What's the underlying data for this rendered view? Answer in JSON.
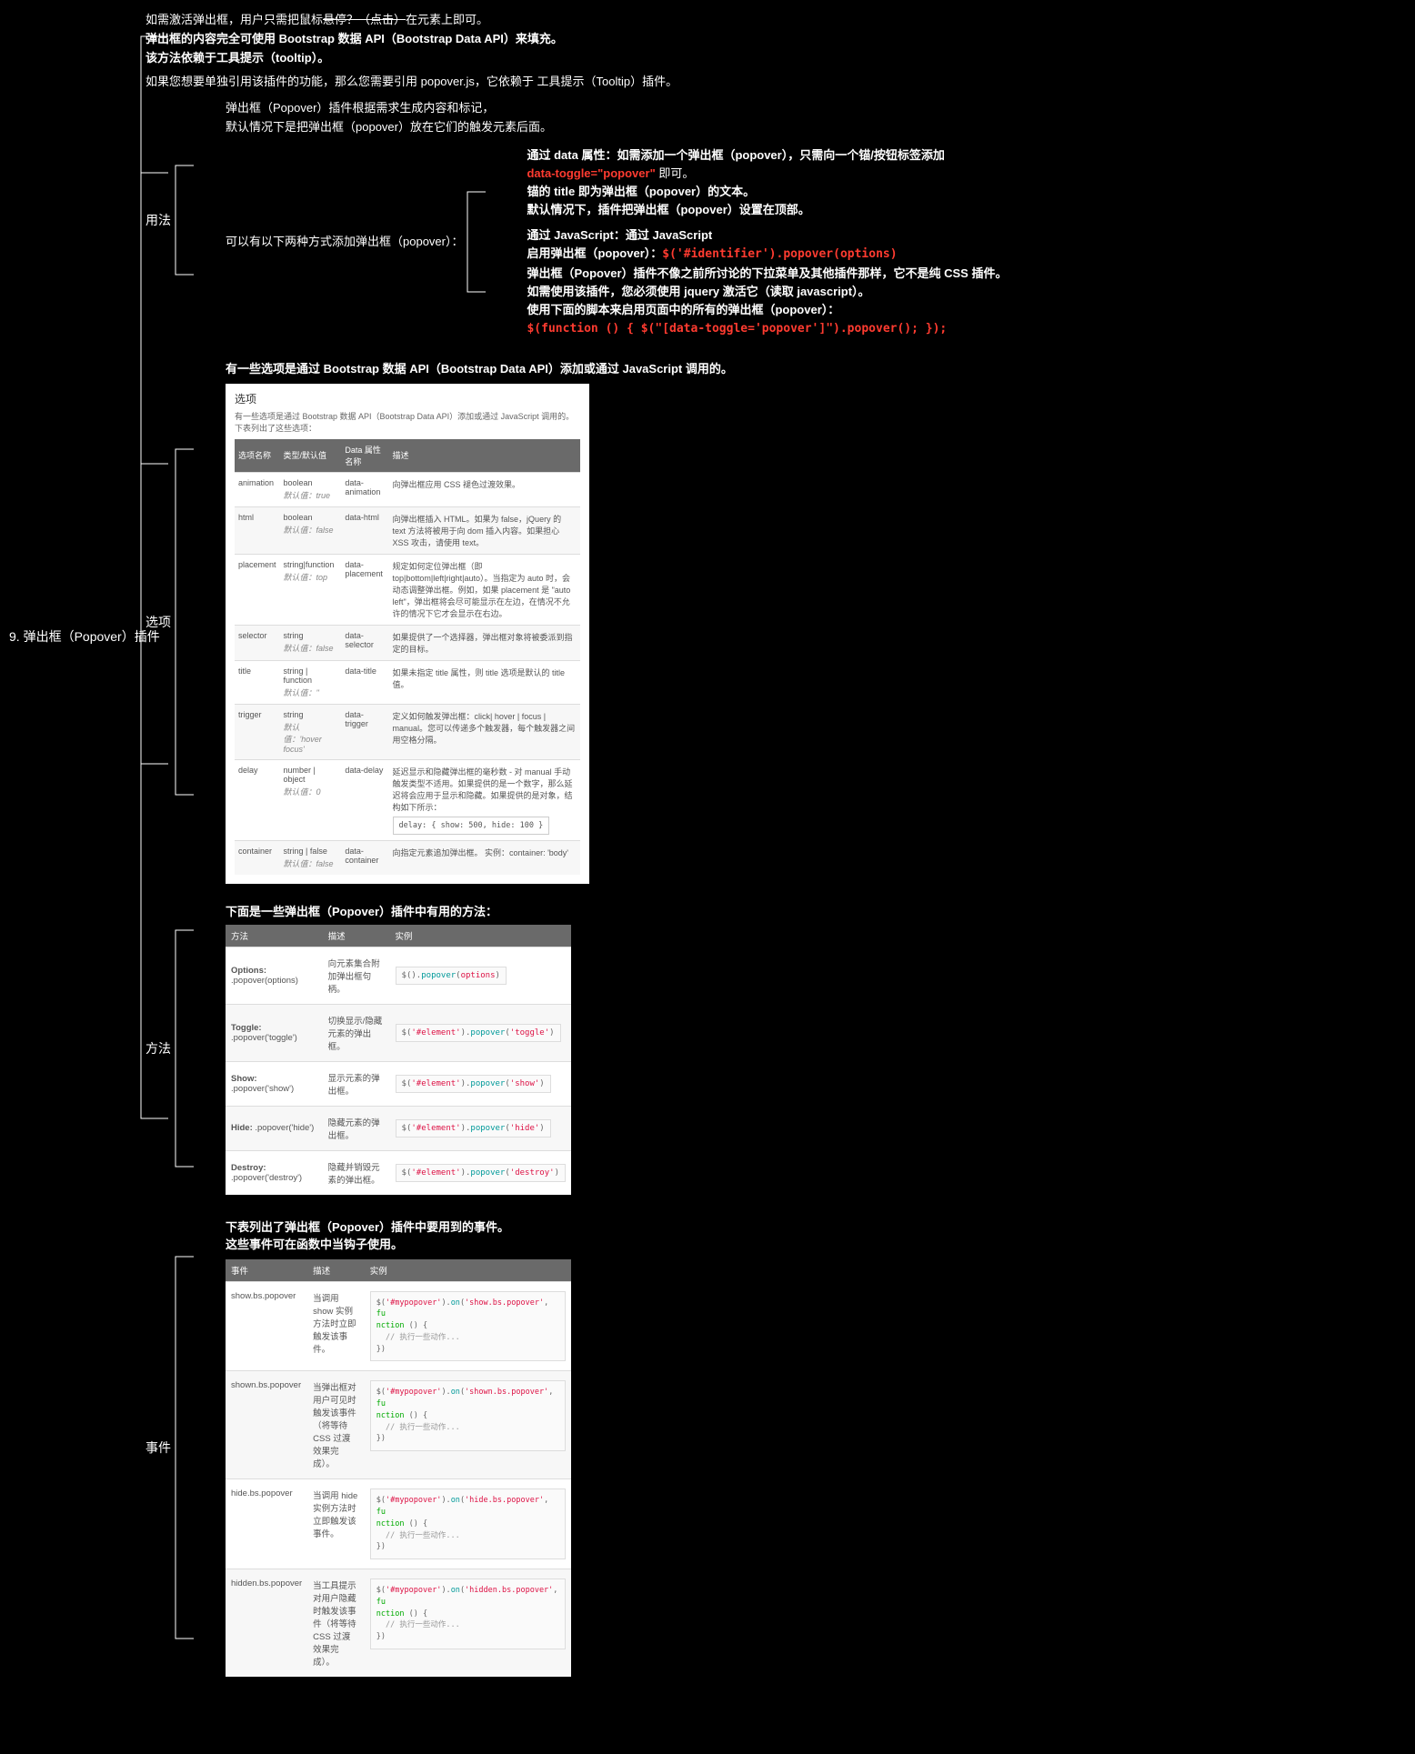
{
  "root": "9. 弹出框（Popover）插件",
  "intro": {
    "l1_a": "如需激活弹出框，用户只需把鼠标",
    "l1_strike": "悬停？（点击）",
    "l1_b": "在元素上即可。",
    "l2": "弹出框的内容完全可使用 Bootstrap 数据 API（Bootstrap Data API）来填充。",
    "l3": "该方法依赖于工具提示（tooltip）。",
    "l4": "如果您想要单独引用该插件的功能，那么您需要引用 popover.js，它依赖于 工具提示（Tooltip）插件。"
  },
  "usage": {
    "label": "用法",
    "gen1": "弹出框（Popover）插件根据需求生成内容和标记，",
    "gen2": "默认情况下是把弹出框（popover）放在它们的触发元素后面。",
    "two_ways": "可以有以下两种方式添加弹出框（popover）：",
    "data": {
      "l1": "通过 data 属性：如需添加一个弹出框（popover），只需向一个锚/按钮标签添加",
      "code": "data-toggle=\"popover\"",
      "l1b": " 即可。",
      "l2": "锚的 title 即为弹出框（popover）的文本。",
      "l3": "默认情况下，插件把弹出框（popover）设置在顶部。"
    },
    "js": {
      "l1": "通过 JavaScript：通过 JavaScript",
      "l2a": "启用弹出框（popover）：",
      "code1": "$('#identifier').popover(options)",
      "l3": "弹出框（Popover）插件不像之前所讨论的下拉菜单及其他插件那样，它不是纯 CSS 插件。",
      "l4": "如需使用该插件，您必须使用 jquery 激活它（读取 javascript）。",
      "l5": "使用下面的脚本来启用页面中的所有的弹出框（popover）：",
      "code2": "$(function () { $(\"[data-toggle='popover']\").popover(); });"
    }
  },
  "options": {
    "label": "选项",
    "intro": "有一些选项是通过 Bootstrap 数据 API（Bootstrap Data API）添加或通过 JavaScript 调用的。",
    "panel_title": "选项",
    "panel_sub": "有一些选项是通过 Bootstrap 数据 API（Bootstrap Data API）添加或通过 JavaScript 调用的。下表列出了这些选项：",
    "headers": [
      "选项名称",
      "类型/默认值",
      "Data 属性名称",
      "描述"
    ],
    "rows": [
      {
        "name": "animation",
        "type": "boolean",
        "def": "默认值：true",
        "attr": "data-animation",
        "desc": "向弹出框应用 CSS 褪色过渡效果。"
      },
      {
        "name": "html",
        "type": "boolean",
        "def": "默认值：false",
        "attr": "data-html",
        "desc": "向弹出框插入 HTML。如果为 false，jQuery 的 text 方法将被用于向 dom 插入内容。如果担心 XSS 攻击，请使用 text。"
      },
      {
        "name": "placement",
        "type": "string|function",
        "def": "默认值：top",
        "attr": "data-placement",
        "desc": "规定如何定位弹出框（即 top|bottom|left|right|auto）。当指定为 auto 时，会动态调整弹出框。例如，如果 placement 是 \"auto left\"，弹出框将会尽可能显示在左边，在情况不允许的情况下它才会显示在右边。"
      },
      {
        "name": "selector",
        "type": "string",
        "def": "默认值：false",
        "attr": "data-selector",
        "desc": "如果提供了一个选择器，弹出框对象将被委派到指定的目标。"
      },
      {
        "name": "title",
        "type": "string | function",
        "def": "默认值：''",
        "attr": "data-title",
        "desc": "如果未指定 title 属性，则 title 选项是默认的 title 值。"
      },
      {
        "name": "trigger",
        "type": "string",
        "def": "默认值：'hover focus'",
        "attr": "data-trigger",
        "desc": "定义如何触发弹出框：click| hover | focus | manual。您可以传递多个触发器，每个触发器之间用空格分隔。"
      },
      {
        "name": "delay",
        "type": "number | object",
        "def": "默认值：0",
        "attr": "data-delay",
        "desc": "延迟显示和隐藏弹出框的毫秒数 - 对 manual 手动触发类型不适用。如果提供的是一个数字，那么延迟将会应用于显示和隐藏。如果提供的是对象，结构如下所示：",
        "code": "delay:\n{ show: 500, hide: 100 }"
      },
      {
        "name": "container",
        "type": "string | false",
        "def": "默认值：false",
        "attr": "data-container",
        "desc": "向指定元素追加弹出框。\n实例：container: 'body'"
      }
    ]
  },
  "methods": {
    "label": "方法",
    "intro": "下面是一些弹出框（Popover）插件中有用的方法：",
    "headers": [
      "方法",
      "描述",
      "实例"
    ],
    "rows": [
      {
        "name": "Options:",
        "sig": ".popover(options)",
        "desc": "向元素集合附加弹出框句柄。",
        "code": "$().popover(options)"
      },
      {
        "name": "Toggle:",
        "sig": ".popover('toggle')",
        "desc": "切换显示/隐藏元素的弹出框。",
        "code": "$('#element').popover('toggle')"
      },
      {
        "name": "Show:",
        "sig": ".popover('show')",
        "desc": "显示元素的弹出框。",
        "code": "$('#element').popover('show')"
      },
      {
        "name": "Hide:",
        "sig": ".popover('hide')",
        "desc": "隐藏元素的弹出框。",
        "code": "$('#element').popover('hide')"
      },
      {
        "name": "Destroy:",
        "sig": ".popover('destroy')",
        "desc": "隐藏并销毁元素的弹出框。",
        "code": "$('#element').popover('destroy')"
      }
    ]
  },
  "events": {
    "label": "事件",
    "intro": "下表列出了弹出框（Popover）插件中要用到的事件。\n这些事件可在函数中当钩子使用。",
    "headers": [
      "事件",
      "描述",
      "实例"
    ],
    "rows": [
      {
        "name": "show.bs.popover",
        "desc": "当调用 show 实例方法时立即触发该事件。",
        "evt": "show.bs.popover"
      },
      {
        "name": "shown.bs.popover",
        "desc": "当弹出框对用户可见时触发该事件（将等待 CSS 过渡效果完成）。",
        "evt": "shown.bs.popover"
      },
      {
        "name": "hide.bs.popover",
        "desc": "当调用 hide 实例方法时立即触发该事件。",
        "evt": "hide.bs.popover"
      },
      {
        "name": "hidden.bs.popover",
        "desc": "当工具提示对用户隐藏时触发该事件（将等待 CSS 过渡效果完成）。",
        "evt": "hidden.bs.popover"
      }
    ],
    "code_tpl_sel": "'#mypopover'",
    "code_tpl_fn": "function () {",
    "code_tpl_cmt": "// 执行一些动作...",
    "code_tpl_end": "})"
  }
}
